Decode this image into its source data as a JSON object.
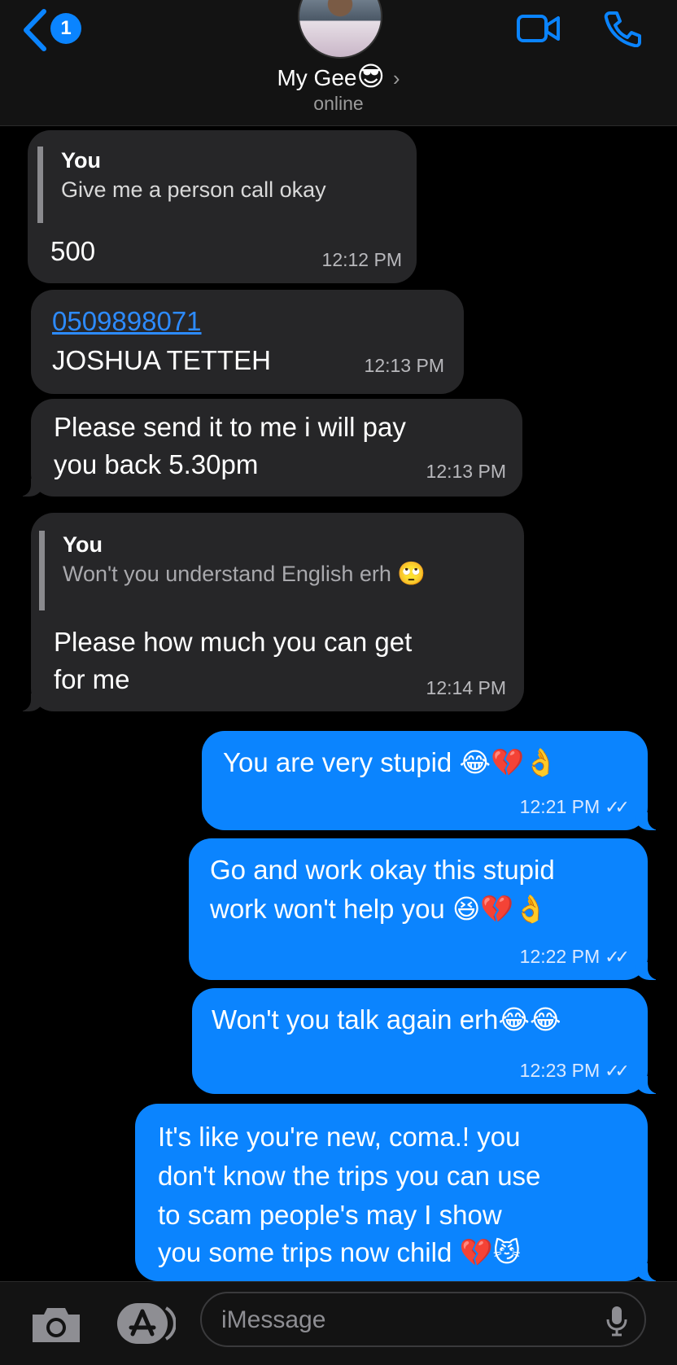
{
  "header": {
    "back_badge": "1",
    "contact_name": "My Gee",
    "contact_emoji": "😎",
    "chevron": "›",
    "status": "online",
    "icons": [
      "back-chevron-icon",
      "avatar",
      "video-call-icon",
      "phone-icon"
    ]
  },
  "messages": [
    {
      "dir": "in",
      "quote_author": "You",
      "quote_text": "Give me a person call okay",
      "text": "500",
      "time": "12:12 PM"
    },
    {
      "dir": "in",
      "link": "0509898071",
      "text": "JOSHUA TETTEH",
      "time": "12:13 PM"
    },
    {
      "dir": "in",
      "text_l1": "Please send it to me i will pay",
      "text_l2": "you back 5.30pm",
      "time": "12:13 PM"
    },
    {
      "dir": "in",
      "quote_author": "You",
      "quote_text": "Won't you understand English erh",
      "quote_emoji": "🙄",
      "text_l1": "Please how much you can get",
      "text_l2": "for me",
      "time": "12:14 PM"
    },
    {
      "dir": "out",
      "text": "You are very stupid",
      "emoji": "😂💔👌",
      "time": "12:21 PM",
      "ticks": "✓✓"
    },
    {
      "dir": "out",
      "text_l1": "Go and work okay this stupid",
      "text_l2": "work won't help you",
      "emoji": "😆💔👌",
      "time": "12:22 PM",
      "ticks": "✓✓"
    },
    {
      "dir": "out",
      "text": "Won't you talk again erh",
      "emoji": "😂😂",
      "time": "12:23 PM",
      "ticks": "✓✓"
    },
    {
      "dir": "out",
      "text_l1": "It's like you're new, coma.! you",
      "text_l2": "don't know the trips you can use",
      "text_l3": "to scam people's may I show",
      "text_l4": "you some trips now child",
      "emoji": "💔😼"
    }
  ],
  "input_bar": {
    "placeholder": "iMessage",
    "icons": [
      "camera-icon",
      "app-store-icon",
      "microphone-icon"
    ]
  },
  "colors": {
    "incoming_bubble": "#262628",
    "outgoing_bubble": "#0b84fe",
    "accent": "#0a84ff",
    "background": "#000000"
  }
}
